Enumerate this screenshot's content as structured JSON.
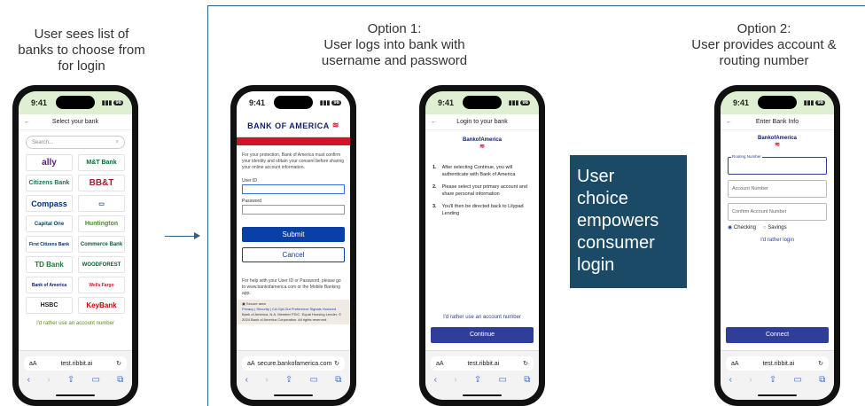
{
  "captions": {
    "left": [
      "User sees list of",
      "banks to choose from",
      "for login"
    ],
    "option1": [
      "Option 1:",
      "User logs into bank with",
      "username and password"
    ],
    "option2": [
      "Option 2:",
      "User provides account &",
      "routing number"
    ]
  },
  "callout": [
    "User",
    "choice",
    "empowers",
    "consumer",
    "login"
  ],
  "status": {
    "time": "9:41",
    "battery": "98"
  },
  "phone1": {
    "title": "Select your bank",
    "search_placeholder": "Search...",
    "banks": [
      "ally",
      "M&T Bank",
      "Citizens Bank",
      "BB&T",
      "Compass",
      "",
      "Capital One",
      "Huntington",
      "First Citizens Bank",
      "Commerce Bank",
      "TD Bank",
      "WOODFOREST",
      "Bank of America",
      "Wells Fargo",
      "HSBC",
      "KeyBank"
    ],
    "link": "I'd rather use an account number",
    "url": "test.ribbit.ai"
  },
  "phone2": {
    "brand": "BANK OF AMERICA",
    "intro": "For your protection, Bank of America must confirm your identity and obtain your consent before sharing your online account information.",
    "userid_label": "User ID",
    "password_label": "Password",
    "submit": "Submit",
    "cancel": "Cancel",
    "help": "For help with your User ID or Password, please go to www.bankofamerica.com or the Mobile Banking app.",
    "secure": "Secure area",
    "footer_links": "Privacy | Security | CA Opt-Out Preference Signals Honored",
    "footer_legal": "Bank of America, N.A. Member FDIC. Equal Housing Lender. © 2024 Bank of America Corporation. All rights reserved.",
    "url": "secure.bankofamerica.com"
  },
  "phone3": {
    "title": "Login to your bank",
    "brand": "BankofAmerica",
    "steps": [
      "After selecting Continue, you will authenticate with Bank of America",
      "Please select your primary account and share personal information",
      "You'll then be directed back to Lilypad Lending"
    ],
    "link": "I'd rather use an account number",
    "continue": "Continue",
    "url": "test.ribbit.ai"
  },
  "phone4": {
    "title": "Enter Bank Info",
    "brand": "BankofAmerica",
    "routing_label": "Routing Number",
    "account_placeholder": "Account Number",
    "confirm_placeholder": "Confirm Account Number",
    "checking": "Checking",
    "savings": "Savings",
    "link": "I'd rather login",
    "connect": "Connect",
    "url": "test.ribbit.ai"
  },
  "colors": {
    "status_bg": "#dff0d2",
    "callout_bg": "#1b4a67",
    "primary_btn": "#2f3f99",
    "boa_red": "#d0152b"
  }
}
